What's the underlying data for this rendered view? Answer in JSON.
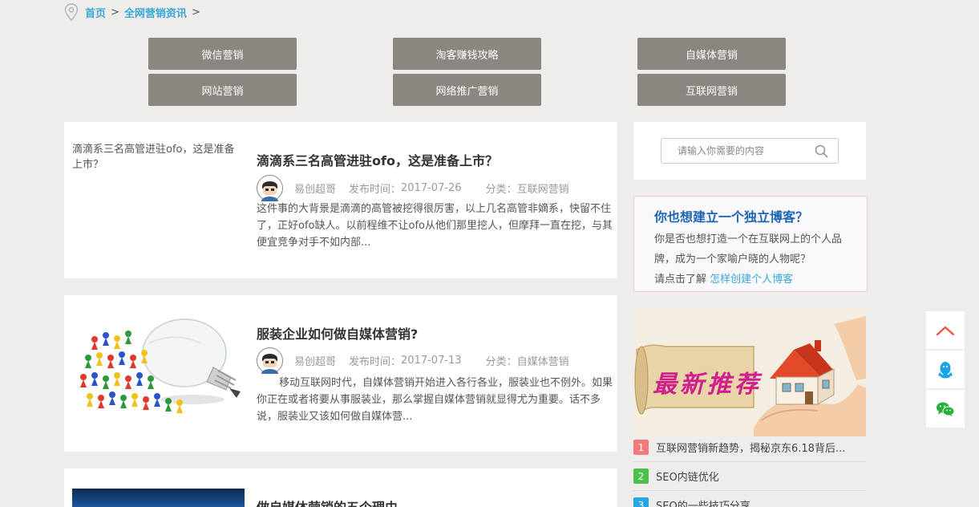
{
  "breadcrumb": {
    "home": "首页",
    "category": "全网营销资讯",
    "sep1": ">",
    "sep2": ">"
  },
  "categories": [
    "微信营销",
    "淘客赚钱攻略",
    "自媒体营销",
    "网站营销",
    "网络推广营销",
    "互联网营销"
  ],
  "articles": [
    {
      "image_alt": "滴滴系三名高管进驻ofo，这是准备上市？",
      "title": "滴滴系三名高管进驻ofo，这是准备上市？",
      "author": "易创超哥",
      "date_label": "发布时间：",
      "date": "2017-07-26",
      "category": "分类：互联网营销",
      "excerpt": "这件事的大背景是滴滴的高管被挖得很厉害，以上几名高管非嫡系，快留不住了，正好ofo缺人。以前程维不让ofo从他们那里挖人，但摩拜一直在挖，与其便宜竞争对手不如内部..."
    },
    {
      "title": "服装企业如何做自媒体营销?",
      "author": "易创超哥",
      "date_label": "发布时间：",
      "date": "2017-07-13",
      "category": "分类：自媒体营销",
      "excerpt": "移动互联网时代，自媒体营销开始进入各行各业，服装业也不例外。如果你正在或者将要从事服装业，那么掌握自媒体营销就显得尤为重要。话不多说，服装业又该如何做自媒体营..."
    },
    {
      "title": "做自媒体营销的五个理由"
    }
  ],
  "search": {
    "placeholder": "请输入你需要的内容"
  },
  "promo": {
    "heading": "你也想建立一个独立博客？",
    "text": "你是否也想打造一个在互联网上的个人品牌，成为一个家喻户晓的人物呢？",
    "cta_prefix": "请点击了解",
    "cta_link": "怎样创建个人博客"
  },
  "recommend": {
    "banner_text": "最新推荐"
  },
  "rank_list": [
    {
      "num": "1",
      "color": "#f27a7a",
      "text": "互联网营销新趋势，揭秘京东6.18背后..."
    },
    {
      "num": "2",
      "color": "#4cbf4c",
      "text": "SEO内链优化"
    },
    {
      "num": "3",
      "color": "#24a6e0",
      "text": "SEO的一些技巧分享"
    }
  ],
  "colors": {
    "category_button": "#8b8680",
    "link": "#3aa7d6",
    "promo_heading": "#1e66b4"
  },
  "float_bar": [
    "chevron-up-icon",
    "qq-icon",
    "wechat-icon"
  ]
}
